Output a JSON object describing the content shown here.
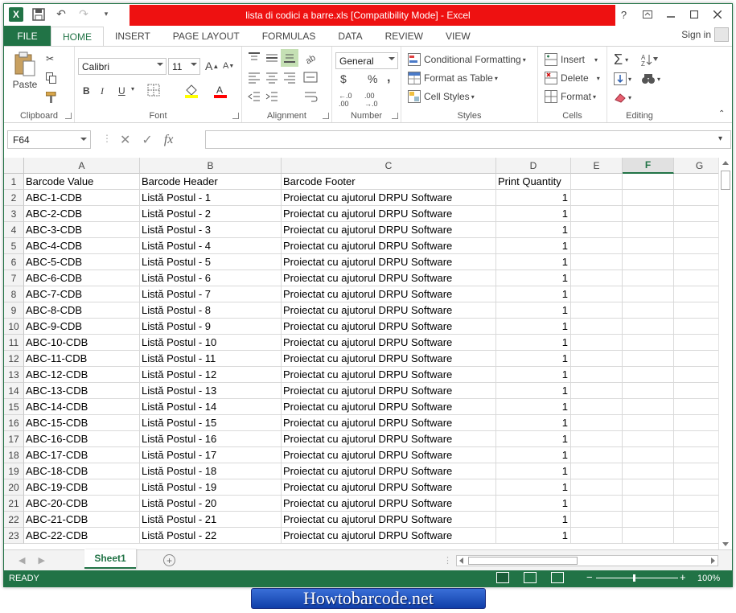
{
  "window": {
    "title": "lista di codici a barre.xls  [Compatibility Mode] -  Excel",
    "help": "?",
    "controls": [
      "help",
      "restore-ribbon",
      "minimize",
      "maximize",
      "close"
    ]
  },
  "colors": {
    "accent": "#217346",
    "title_highlight": "#ee1111",
    "banner": "#1e4fc4"
  },
  "ribbon": {
    "tabs": [
      "FILE",
      "HOME",
      "INSERT",
      "PAGE LAYOUT",
      "FORMULAS",
      "DATA",
      "REVIEW",
      "VIEW"
    ],
    "active_tab": "HOME",
    "sign_in": "Sign in",
    "clipboard": {
      "label": "Clipboard",
      "paste": "Paste"
    },
    "font": {
      "label": "Font",
      "name": "Calibri",
      "size": "11",
      "bold": "B",
      "italic": "I",
      "underline": "U"
    },
    "alignment": {
      "label": "Alignment"
    },
    "number": {
      "label": "Number",
      "format": "General",
      "currency": "$",
      "percent": "%",
      "comma": ","
    },
    "styles": {
      "label": "Styles",
      "conditional": "Conditional Formatting",
      "format_table": "Format as Table",
      "cell_styles": "Cell Styles"
    },
    "cells": {
      "label": "Cells",
      "insert": "Insert",
      "delete": "Delete",
      "format": "Format"
    },
    "editing": {
      "label": "Editing"
    }
  },
  "formula_bar": {
    "name_box": "F64",
    "fx": "fx",
    "value": ""
  },
  "grid": {
    "columns": [
      "A",
      "B",
      "C",
      "D",
      "E",
      "F",
      "G"
    ],
    "selected_column": "F",
    "headers": [
      "Barcode Value",
      "Barcode Header",
      "Barcode Footer",
      "Print Quantity"
    ],
    "rows": [
      [
        "ABC-1-CDB",
        "Listă Postul - 1",
        "Proiectat cu ajutorul DRPU Software",
        "1"
      ],
      [
        "ABC-2-CDB",
        "Listă Postul - 2",
        "Proiectat cu ajutorul DRPU Software",
        "1"
      ],
      [
        "ABC-3-CDB",
        "Listă Postul - 3",
        "Proiectat cu ajutorul DRPU Software",
        "1"
      ],
      [
        "ABC-4-CDB",
        "Listă Postul - 4",
        "Proiectat cu ajutorul DRPU Software",
        "1"
      ],
      [
        "ABC-5-CDB",
        "Listă Postul - 5",
        "Proiectat cu ajutorul DRPU Software",
        "1"
      ],
      [
        "ABC-6-CDB",
        "Listă Postul - 6",
        "Proiectat cu ajutorul DRPU Software",
        "1"
      ],
      [
        "ABC-7-CDB",
        "Listă Postul - 7",
        "Proiectat cu ajutorul DRPU Software",
        "1"
      ],
      [
        "ABC-8-CDB",
        "Listă Postul - 8",
        "Proiectat cu ajutorul DRPU Software",
        "1"
      ],
      [
        "ABC-9-CDB",
        "Listă Postul - 9",
        "Proiectat cu ajutorul DRPU Software",
        "1"
      ],
      [
        "ABC-10-CDB",
        "Listă Postul - 10",
        "Proiectat cu ajutorul DRPU Software",
        "1"
      ],
      [
        "ABC-11-CDB",
        "Listă Postul - 11",
        "Proiectat cu ajutorul DRPU Software",
        "1"
      ],
      [
        "ABC-12-CDB",
        "Listă Postul - 12",
        "Proiectat cu ajutorul DRPU Software",
        "1"
      ],
      [
        "ABC-13-CDB",
        "Listă Postul - 13",
        "Proiectat cu ajutorul DRPU Software",
        "1"
      ],
      [
        "ABC-14-CDB",
        "Listă Postul - 14",
        "Proiectat cu ajutorul DRPU Software",
        "1"
      ],
      [
        "ABC-15-CDB",
        "Listă Postul - 15",
        "Proiectat cu ajutorul DRPU Software",
        "1"
      ],
      [
        "ABC-16-CDB",
        "Listă Postul - 16",
        "Proiectat cu ajutorul DRPU Software",
        "1"
      ],
      [
        "ABC-17-CDB",
        "Listă Postul - 17",
        "Proiectat cu ajutorul DRPU Software",
        "1"
      ],
      [
        "ABC-18-CDB",
        "Listă Postul - 18",
        "Proiectat cu ajutorul DRPU Software",
        "1"
      ],
      [
        "ABC-19-CDB",
        "Listă Postul - 19",
        "Proiectat cu ajutorul DRPU Software",
        "1"
      ],
      [
        "ABC-20-CDB",
        "Listă Postul - 20",
        "Proiectat cu ajutorul DRPU Software",
        "1"
      ],
      [
        "ABC-21-CDB",
        "Listă Postul - 21",
        "Proiectat cu ajutorul DRPU Software",
        "1"
      ],
      [
        "ABC-22-CDB",
        "Listă Postul - 22",
        "Proiectat cu ajutorul DRPU Software",
        "1"
      ]
    ]
  },
  "sheets": {
    "tabs": [
      "Sheet1"
    ],
    "active": "Sheet1"
  },
  "status": {
    "ready": "READY",
    "zoom": "100%"
  },
  "watermark": "Howtobarcode.net"
}
